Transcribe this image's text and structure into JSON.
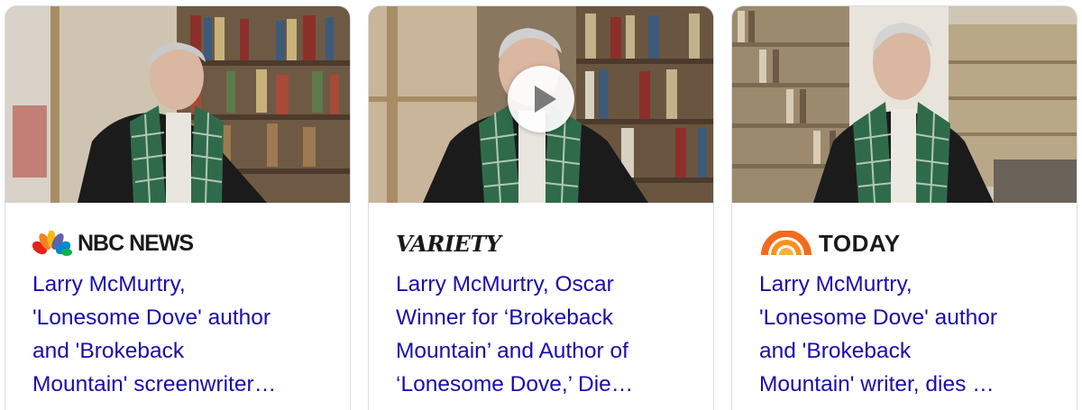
{
  "cards": [
    {
      "source": "NBC NEWS",
      "logo_icon": "nbc-peacock-icon",
      "headline_lines": [
        "Larry McMurtry,",
        "'Lonesome Dove' author",
        "and 'Brokeback",
        "Mountain' screenwriter…"
      ],
      "has_video": false
    },
    {
      "source": "VARIETY",
      "logo_icon": "variety-wordmark",
      "headline_lines": [
        "Larry McMurtry, Oscar",
        "Winner for ‘Brokeback",
        "Mountain’ and Author of",
        "‘Lonesome Dove,’ Die…"
      ],
      "has_video": true
    },
    {
      "source": "TODAY",
      "logo_icon": "today-sunrise-icon",
      "headline_lines": [
        "Larry McMurtry,",
        "'Lonesome Dove' author",
        "and 'Brokeback",
        "Mountain' writer, dies …"
      ],
      "has_video": false
    }
  ],
  "colors": {
    "link": "#1a0dab",
    "border": "#dadce0",
    "scarf_green": "#2f6b4a",
    "today_orange": "#f26b1d"
  }
}
